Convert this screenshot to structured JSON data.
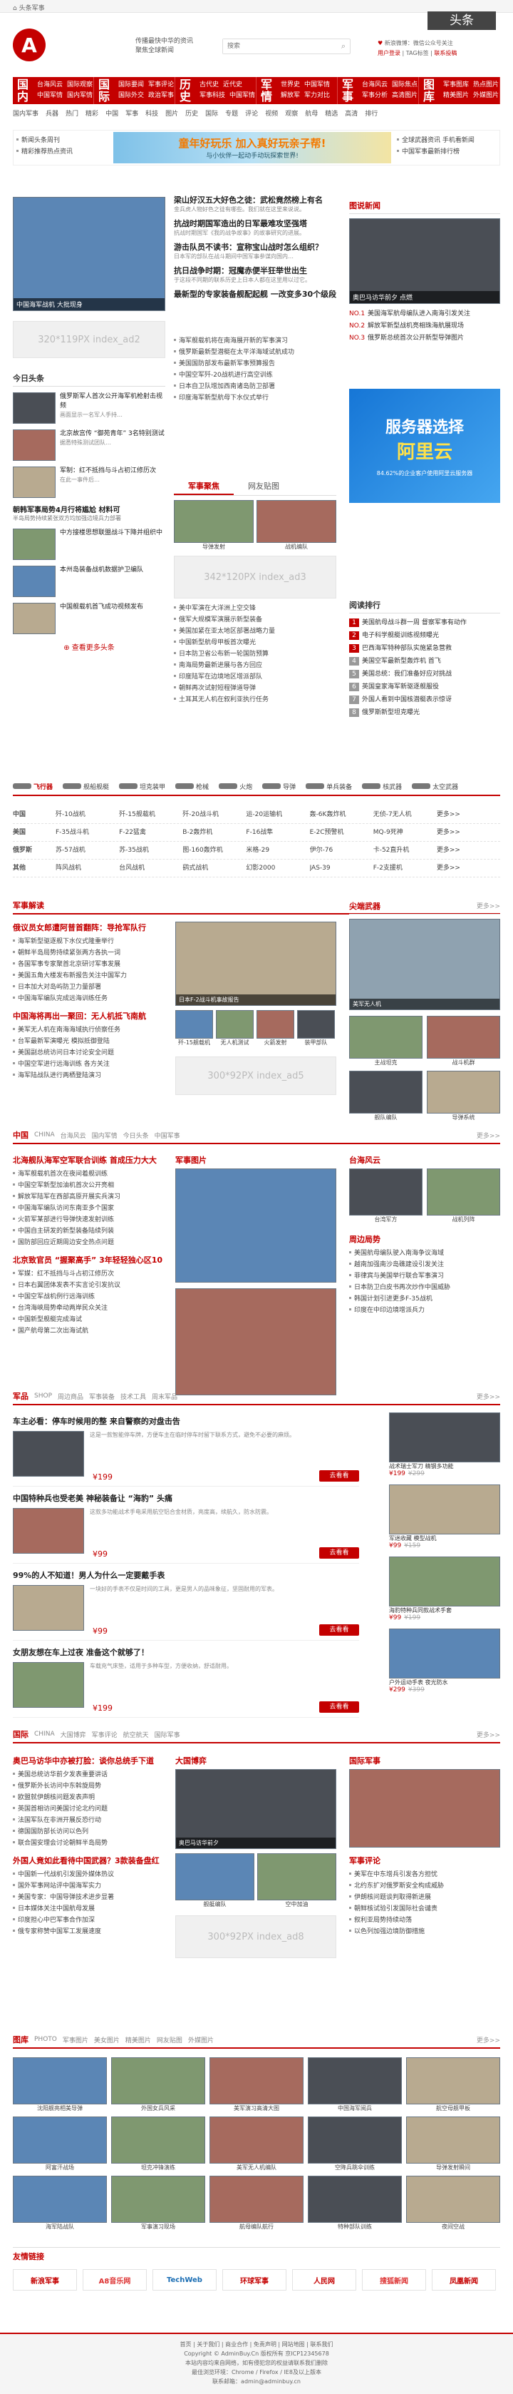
{
  "topbar": {
    "home": "头条军事",
    "slogan": [
      "传播最快中华的资讯",
      "聚焦全球新闻"
    ],
    "search_placeholder": "搜索",
    "weibo": "新浪微博：微信公众号关注",
    "banner_text": "头条",
    "links": [
      "用户登录",
      "TAG标签",
      "联系投稿"
    ]
  },
  "nav": [
    {
      "head": "国内",
      "items": [
        [
          "台海风云",
          "国际观察"
        ],
        [
          "中国军情",
          "国内军情"
        ]
      ]
    },
    {
      "head": "国际",
      "items": [
        [
          "国际要闻",
          "军事评论"
        ],
        [
          "国际外交",
          "政治军事"
        ]
      ]
    },
    {
      "head": "历史",
      "items": [
        [
          "古代史",
          "近代史"
        ],
        [
          "军事科技",
          "中国军情"
        ]
      ]
    },
    {
      "head": "军情",
      "items": [
        [
          "世界史",
          "中国军情"
        ],
        [
          "解放军",
          "军力对比"
        ]
      ]
    },
    {
      "head": "军事",
      "items": [
        [
          "台海风云",
          "国际焦点"
        ],
        [
          "军事分析",
          "高清图片"
        ]
      ]
    },
    {
      "head": "图库",
      "items": [
        [
          "军事图库",
          "热点图片"
        ],
        [
          "精美图片",
          "外媒图片"
        ]
      ]
    }
  ],
  "subnav": [
    "国内军事",
    "兵器",
    "热门",
    "精彩",
    "中国",
    "军事",
    "科技",
    "图片",
    "历史",
    "国际",
    "专题",
    "评论",
    "视频",
    "观察",
    "航母",
    "精选",
    "高清",
    "排行"
  ],
  "banner": {
    "title": "童年好玩乐 加入真好玩亲子帮!",
    "sub": "与小伙伴一起动手动玩探索世界!",
    "side": [
      "全球武器资讯 手机看新闻",
      "中国军事最新排行榜"
    ],
    "left": [
      "新闻头条周刊",
      "精彩推荐热点资讯"
    ]
  },
  "focus": {
    "caption": "中国海军战机 大批现身",
    "ph": "320*119PX index_ad2"
  },
  "headline": [
    {
      "title": "梁山好汉五大好色之徒：武松竟然榜上有名",
      "desc": "金兵虎人物好色之徒有哪些。我们就在这里来说说。"
    },
    {
      "title": "抗战时期国军造出的日军最难攻坚强塔",
      "desc": "抗战时期国军《我的战争故事》的故事研究的进展。"
    },
    {
      "title": "游击队员不读书：宣称宝山战时怎么组织？",
      "desc": "日本军的部队在战斗期间中国军事参谋向国内…"
    },
    {
      "title": "抗日战争时期：冠魔赤便半狂举世出生",
      "desc": "于这段不同期的联系历史上日本人都在这里用以过它。"
    },
    {
      "title": "最新型的专家装备舰配起舰 一改变多30个级段",
      "desc": ""
    }
  ],
  "headline_list": [
    "海军舰载机将在南海展开新的军事演习",
    "俄罗斯最新型潜艇在太平洋海域试航成功",
    "美国国防部发布最新军事预算报告",
    "中国空军歼-20战机进行高空训练",
    "日本自卫队增加西南诸岛防卫部署",
    "印度海军新型航母下水仪式举行"
  ],
  "imgnews": {
    "head": "图说新闻",
    "caption": "奥巴马访华前夕 点燃",
    "list": [
      {
        "n": "NO.1",
        "t": "美国海军航母编队进入南海引发关注"
      },
      {
        "n": "NO.2",
        "t": "解放军新型战机亮相珠海航展现场"
      },
      {
        "n": "NO.3",
        "t": "俄罗斯总统首次公开新型导弹图片"
      }
    ]
  },
  "toutiao": {
    "head": "今日头条",
    "items": [
      {
        "t": "俄罗斯军人首次公开海军机枪射击视频",
        "d": "画面显示一名军人手持…"
      },
      {
        "t": "北京故宫传 “御苑青年” 3名特别测试",
        "d": "据悉特殊测试团队…"
      },
      {
        "t": "军制：红不抵挡与斗占初江修历次",
        "d": "在此一事件后…"
      }
    ],
    "more": "查看更多头条",
    "hot": {
      "t": "朝韩军事局势4月行将尴尬 材料可",
      "d": "半岛局势持续紧张双方均加强边境兵力部署"
    },
    "items2": [
      {
        "t": "中方接楼思想联盟战斗下降并组织中",
        "d": ""
      },
      {
        "t": "本州岛装备战机数据护卫编队",
        "d": ""
      },
      {
        "t": "中国舰载机首飞成功视频发布",
        "d": ""
      }
    ]
  },
  "jsjf": {
    "tabs": [
      "军事聚焦",
      "网友贴图"
    ],
    "caps": [
      "导弹发射",
      "战机编队"
    ],
    "ph": "342*120PX index_ad3",
    "list": [
      "美中军演在大洋洲上空交锋",
      "俄军大规模军演展示新型装备",
      "美国加紧在亚太地区部署战略力量",
      "中国新型航母甲板首次曝光",
      "日本防卫省公布新一轮国防预算",
      "南海局势最新进展与各方回应",
      "印度陆军在边境地区增派部队",
      "朝鲜再次试射短程弹道导弹",
      "土耳其无人机在叙利亚执行任务"
    ]
  },
  "right_ad": {
    "title": "服务器选择",
    "brand": "阿里云",
    "sub": "84.62%的企业客户使用阿里云服务器",
    "hd": "阅读排行",
    "rank": [
      {
        "t": "美国航母战斗群一周 督察军事有动作",
        "n": "1"
      },
      {
        "t": "电子科学舰艇训练视频曝光",
        "n": "2"
      },
      {
        "t": "巴西海军特种部队实施紧急营救",
        "n": "3"
      },
      {
        "t": "美国空军最新型轰炸机 首飞",
        "n": "4"
      },
      {
        "t": "美国总统：我们准备好应对挑战",
        "n": "5"
      },
      {
        "t": "英国皇家海军新驱逐舰服役",
        "n": "6"
      },
      {
        "t": "外国人看到中国核潜艇表示惊讶",
        "n": "7"
      },
      {
        "t": "俄罗斯新型坦克曝光",
        "n": "8"
      }
    ]
  },
  "weapon_tabs": [
    "飞行器",
    "舰船舰艇",
    "坦克装甲",
    "枪械",
    "火炮",
    "导弹",
    "单兵装备",
    "核武器",
    "太空武器"
  ],
  "weapon_table": {
    "rows": [
      {
        "h": "中国",
        "c": [
          "歼-10战机",
          "歼-15舰载机",
          "歼-20战斗机",
          "运-20运输机",
          "轰-6K轰炸机",
          "无侦-7无人机",
          "更多>>"
        ]
      },
      {
        "h": "美国",
        "c": [
          "F-35战斗机",
          "F-22猛禽",
          "B-2轰炸机",
          "F-16战隼",
          "E-2C预警机",
          "MQ-9死神",
          "更多>>"
        ]
      },
      {
        "h": "俄罗斯",
        "c": [
          "苏-57战机",
          "苏-35战机",
          "图-160轰炸机",
          "米格-29",
          "伊尔-76",
          "卡-52直升机",
          "更多>>"
        ]
      },
      {
        "h": "其他",
        "c": [
          "阵风战机",
          "台风战机",
          "鹞式战机",
          "幻影2000",
          "JAS-39",
          "F-2支援机",
          "更多>>"
        ]
      }
    ]
  },
  "news1": {
    "head": "军事解读",
    "hl": "俄议员女郎遭阿普首翻阵：导抢军队行",
    "list": [
      "海军新型驱逐舰下水仪式隆重举行",
      "朝鲜半岛局势持续紧张两方各执一词",
      "各国军事专家聚首北京研讨军事发展",
      "美国五角大楼发布新报告关注中国军力",
      "日本加大对岛屿防卫力量部署",
      "中国海军编队完成远海训练任务"
    ],
    "hl2": "中国海将再出一聚回：无人机抵飞南航",
    "list2": [
      "美军无人机在南海海域执行侦察任务",
      "台军最新军演曝光 模拟抵御登陆",
      "美国副总统访问日本讨论安全问题",
      "中国空军进行远海训练 各方关注",
      "海军陆战队进行两栖登陆演习"
    ],
    "cap": "日本F-2战斗机事故报告",
    "caps": [
      "歼-15舰载机",
      "无人机测试",
      "火箭发射",
      "装甲部队"
    ],
    "ph": "300*92PX index_ad5"
  },
  "news1r": {
    "head": "尖端武器",
    "cap": "美军无人机",
    "caps": [
      "主战坦克",
      "战斗机群",
      "舰队编队",
      "导弹系统"
    ]
  },
  "china": {
    "tabs": [
      "中国",
      "CHINA",
      "台海风云",
      "国内军情",
      "今日头条",
      "中国军事"
    ],
    "hl": "北海舰队海军空军联合训练 首成压力大大",
    "list": [
      "海军舰载机首次在夜间着舰训练",
      "中国空军新型加油机首次公开亮相",
      "解放军陆军在西部高原开展实兵演习",
      "中国海军编队访问东南亚多个国家",
      "火箭军某部进行导弹快速发射训练",
      "中国自主研发的新型装备陆续列装",
      "国防部回应近期周边安全热点问题"
    ],
    "hl2": "北京致官员 “握聚高手” 3年轻轻独心区10",
    "list2": [
      "军媒：红不抵挡与斗占初江修历次",
      "日本右翼团体发表不实言论引发抗议",
      "中国空军战机例行远海训练",
      "台湾海峡局势牵动两岸民众关注",
      "中国新型舰艇完成海试",
      "国产航母第二次出海试航"
    ],
    "photohead": "军事图片",
    "hd3": "台海风云",
    "hd4": "周边局势",
    "caps": [
      "台湾军方",
      "战机列阵"
    ],
    "list4": [
      "美国航母编队驶入南海争议海域",
      "越南加强南沙岛礁建设引发关注",
      "菲律宾与美国举行联合军事演习",
      "日本防卫白皮书再次炒作中国威胁",
      "韩国计划引进更多F-35战机",
      "印度在中印边境增派兵力"
    ]
  },
  "shop": {
    "tabs": [
      "军品",
      "SHOP",
      "周边商品",
      "军事装备",
      "技术工具",
      "周末军品"
    ],
    "items": [
      {
        "t": "车主必看：停车时候用的整 来自警察的对盘击告",
        "d": "这是一款智能停车牌，方便车主在临时停车时留下联系方式，避免不必要的麻烦。",
        "p": "¥199",
        "b": "去看看"
      },
      {
        "t": "中国特种兵也受老美 神秘装备让 “海豹” 头痛",
        "d": "这款多功能战术手电采用航空铝合金材质，亮度高，续航久，防水防震。",
        "p": "¥99",
        "b": "去看看"
      },
      {
        "t": "99%的人不知道！男人为什么一定要戴手表",
        "d": "一块好的手表不仅是时间的工具，更是男人的品味象征，坚固耐用的军表。",
        "p": "¥99",
        "b": "去看看"
      },
      {
        "t": "女朋友想在车上过夜 准备这个就够了！",
        "d": "车载充气床垫，适用于多种车型，方便收纳，舒适耐用。",
        "p": "¥199",
        "b": "去看看"
      }
    ],
    "side": [
      {
        "t": "战术瑞士军刀 精钢多功能",
        "p": "¥199",
        "o": "¥299"
      },
      {
        "t": "军迷收藏 模型战机",
        "p": "¥99",
        "o": "¥159"
      },
      {
        "t": "海豹特种兵同款战术手套",
        "p": "¥99",
        "o": "¥199"
      },
      {
        "t": "户外运动手表 夜光防水",
        "p": "¥299",
        "o": "¥399"
      }
    ]
  },
  "intl": {
    "tabs": [
      "国际",
      "CHINA",
      "大国博弈",
      "军事评论",
      "航空航天",
      "国际军事"
    ],
    "hl": "奥巴马访华中亦被打脸：谈你总统手下道",
    "list": [
      "美国总统访华前夕发表重要讲话",
      "俄罗斯外长访问中东斡旋局势",
      "欧盟就伊朗核问题发表声明",
      "英国首相访问美国讨论北约问题",
      "法国军队在非洲开展反恐行动",
      "德国国防部长访问以色列",
      "联合国安理会讨论朝鲜半岛局势"
    ],
    "hl2": "外国人竟如此看待中国武器？3款装备盘红",
    "list2": [
      "中国新一代战机引发国外媒体热议",
      "国外军事网站评中国海军实力",
      "美国专家：中国导弹技术进步显著",
      "日本媒体关注中国航母发展",
      "印度担心中巴军事合作加深",
      "俄专家称赞中国军工发展速度"
    ],
    "photohead": "大国博弈",
    "cap": "奥巴马访华前夕",
    "caps": [
      "舰艇编队",
      "空中加油"
    ],
    "ph": "300*92PX index_ad8",
    "hd3": "国际军事",
    "hd4": "军事评论",
    "list4": [
      "美军在中东增兵引发各方担忧",
      "北约东扩对俄罗斯安全构成威胁",
      "伊朗核问题谈判取得新进展",
      "朝鲜核试验引发国际社会谴责",
      "叙利亚局势持续动荡",
      "以色列加强边境防御措施"
    ]
  },
  "photos": {
    "tabs": [
      "图库",
      "PHOTO",
      "军事图片",
      "美女图片",
      "精美图片",
      "网友贴图",
      "外媒图片"
    ],
    "caps": [
      "沈阳舰亮相美导弹",
      "外国女兵风采",
      "美军演习高清大图",
      "中国海军阅兵",
      "航空母舰甲板",
      "阿富汗战场",
      "坦克冲锋演练",
      "美军无人机编队",
      "空降兵跳伞训练",
      "导弹发射瞬间",
      "海军陆战队",
      "军事演习现场",
      "航母编队航行",
      "特种部队训练",
      "夜间空战"
    ]
  },
  "friend": {
    "head": "友情链接",
    "logos": [
      "新浪军事",
      "A8音乐网",
      "TechWeb",
      "环球军事",
      "人民网",
      "搜狐新闻",
      "凤凰新闻"
    ]
  },
  "footer": {
    "links": "首页 | 关于我们 | 商业合作 | 免责声明 | 网站地图 | 联系我们",
    "lines": [
      "Copyright © AdminBuy.Cn 版权所有 京ICP12345678",
      "本站内容均来自网络，如有侵犯您的权益请联系我们删除",
      "最佳浏览环境：Chrome / Firefox / IE8及以上版本",
      "联系邮箱：admin@adminbuy.cn"
    ]
  }
}
